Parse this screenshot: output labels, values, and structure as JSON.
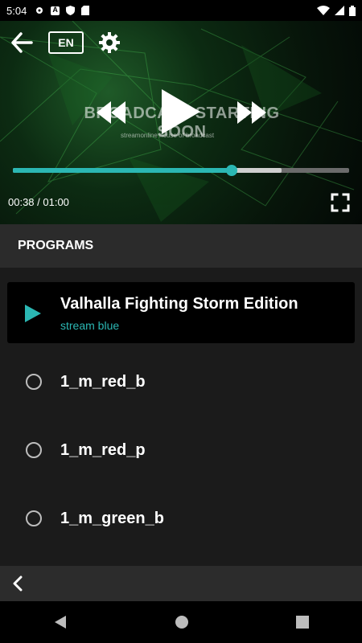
{
  "status_bar": {
    "time": "5:04"
  },
  "player": {
    "language": "EN",
    "brand_text": "BROADCAST STARTING SOON",
    "brand_sub": "streamonline  house of broadcast",
    "time_readout": "00:38 / 01:00",
    "progress": 0.65,
    "buffered": 0.8
  },
  "programs": {
    "header": "PROGRAMS",
    "active": {
      "title": "Valhalla Fighting Storm Edition",
      "subtitle": "stream blue"
    },
    "items": [
      {
        "label": "1_m_red_b"
      },
      {
        "label": "1_m_red_p"
      },
      {
        "label": "1_m_green_b"
      }
    ]
  },
  "colors": {
    "accent": "#2bb7b3",
    "background": "#1b1b1b"
  }
}
